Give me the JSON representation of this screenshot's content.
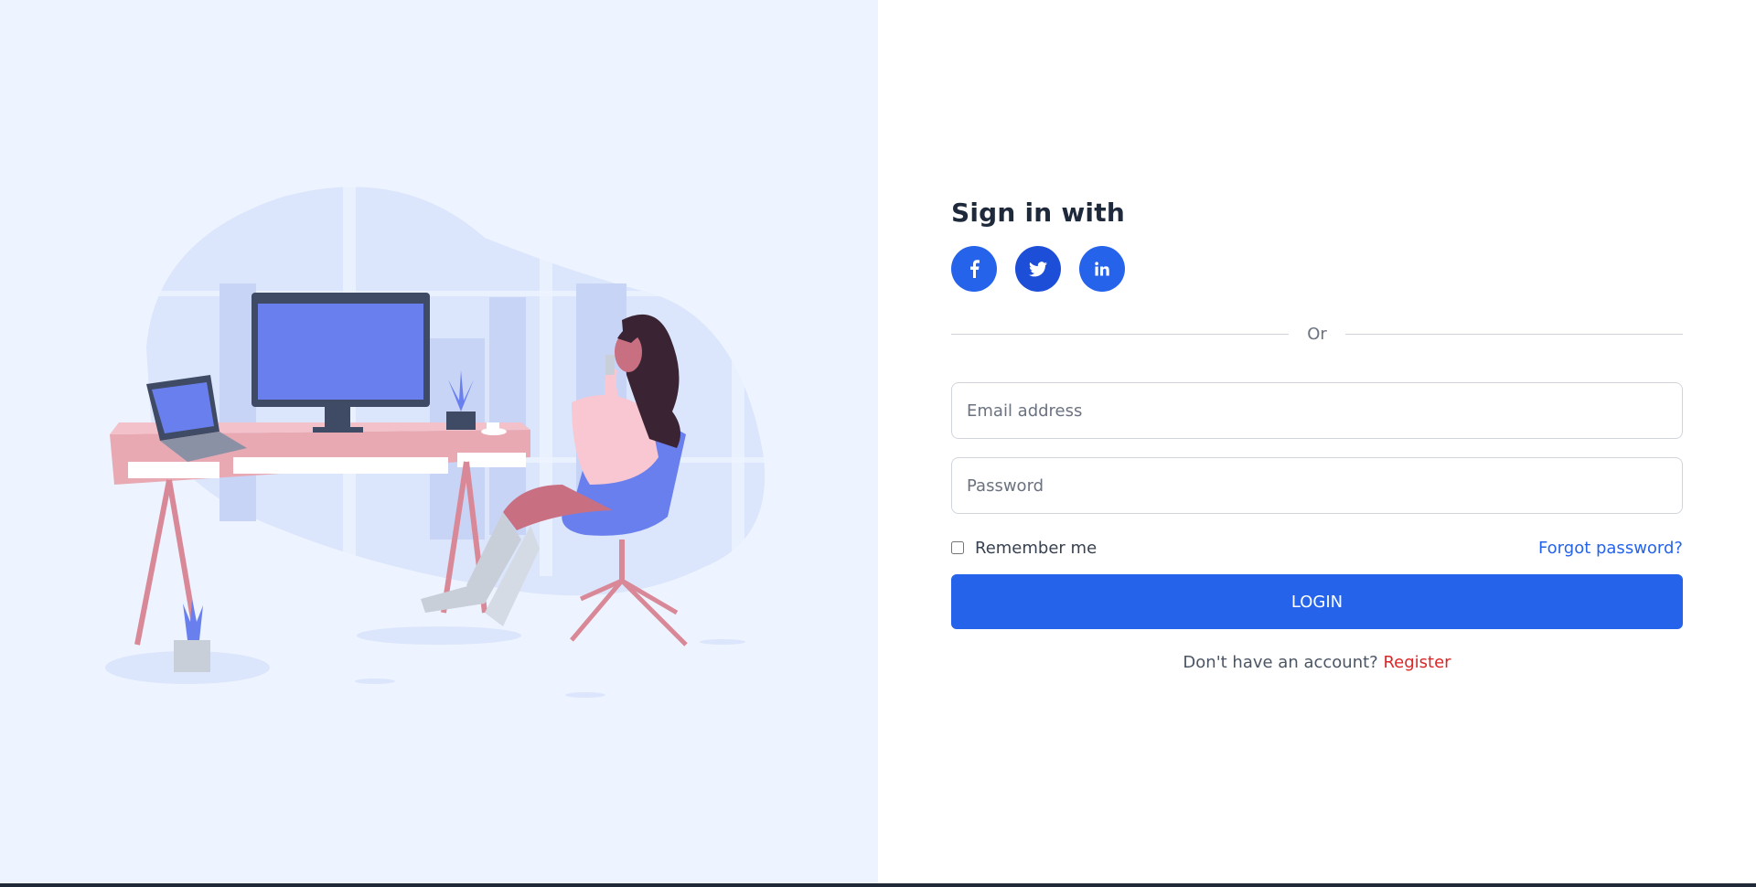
{
  "colors": {
    "left_bg": "#eef4ff",
    "primary": "#2563eb",
    "register_link": "#dc2626"
  },
  "illustration": {
    "description_icon": "woman-at-desk-illustration"
  },
  "signin": {
    "title": "Sign in with",
    "socials": [
      {
        "name": "facebook",
        "icon": "facebook-icon"
      },
      {
        "name": "twitter",
        "icon": "twitter-icon"
      },
      {
        "name": "linkedin",
        "icon": "linkedin-icon"
      }
    ],
    "divider_text": "Or",
    "email_placeholder": "Email address",
    "password_placeholder": "Password",
    "remember_label": "Remember me",
    "forgot_label": "Forgot password?",
    "login_label": "LOGIN",
    "no_account_text": "Don't have an account?",
    "register_label": "Register"
  }
}
